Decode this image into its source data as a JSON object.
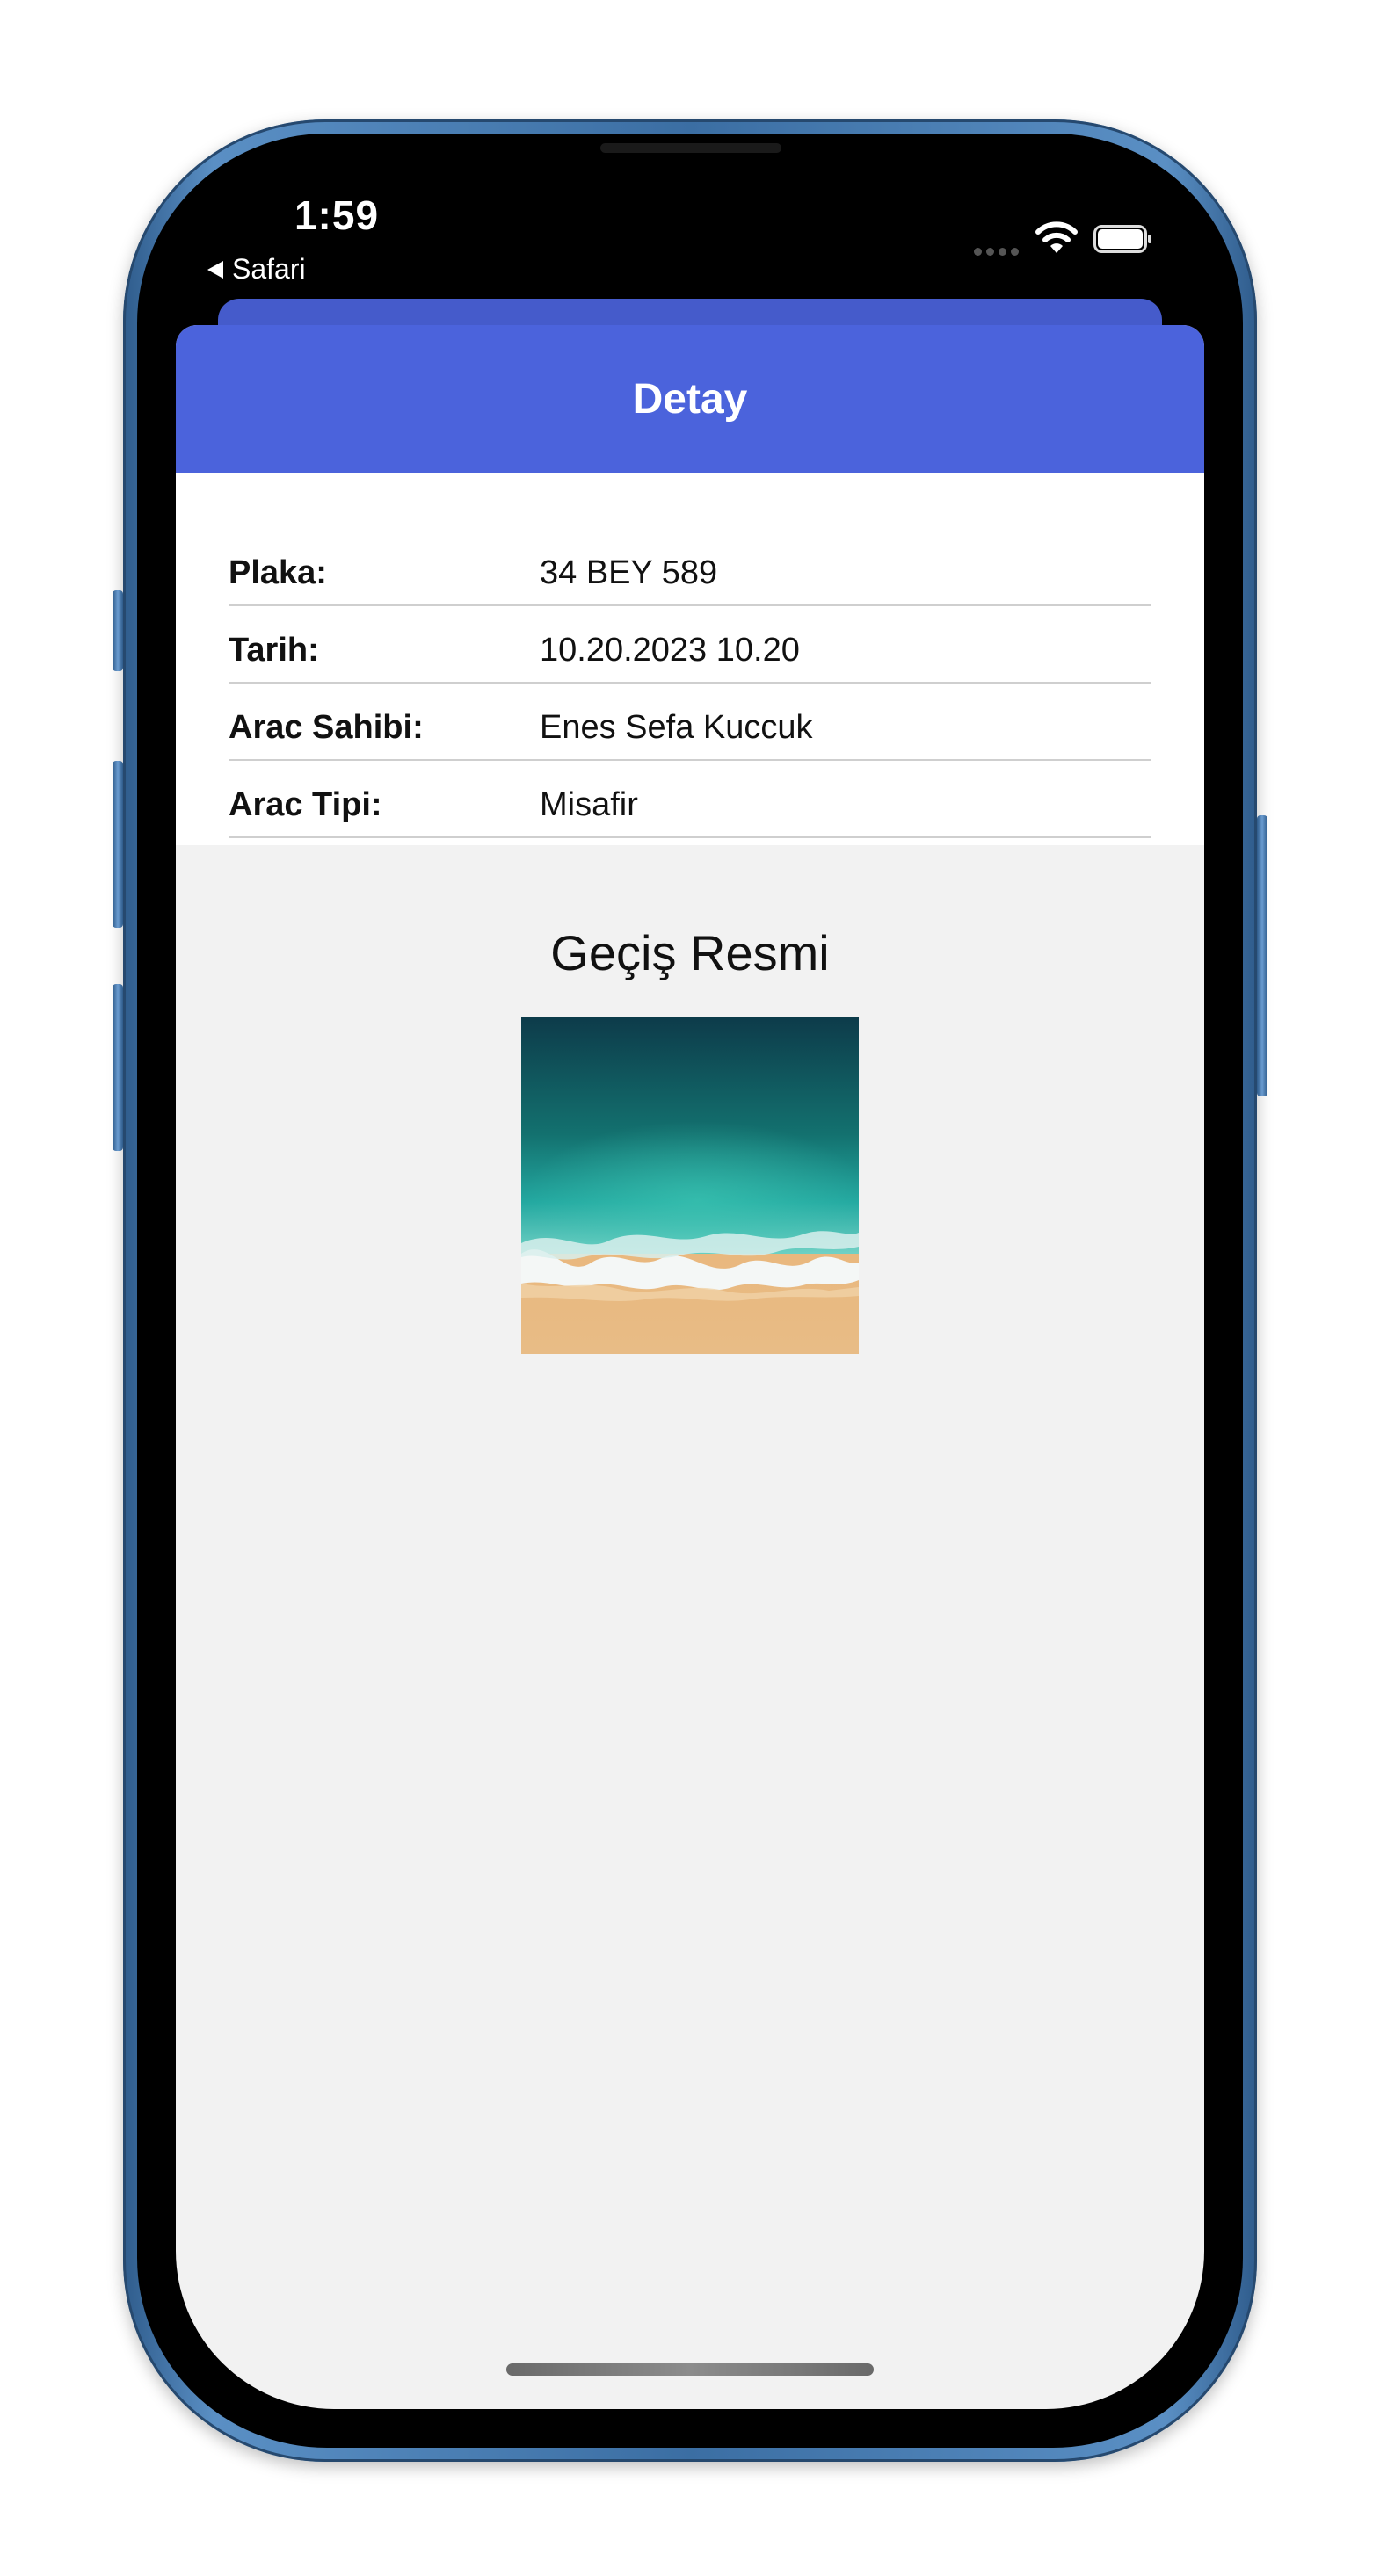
{
  "status_bar": {
    "time": "1:59",
    "back_app": "Safari"
  },
  "header": {
    "title": "Detay"
  },
  "details": [
    {
      "label": "Plaka:",
      "value": "34 BEY 589"
    },
    {
      "label": "Tarih:",
      "value": "10.20.2023 10.20"
    },
    {
      "label": "Arac Sahibi:",
      "value": "Enes Sefa Kuccuk"
    },
    {
      "label": "Arac Tipi:",
      "value": "Misafir"
    }
  ],
  "image_section": {
    "title": "Geçiş Resmi"
  },
  "colors": {
    "accent": "#4b63dc",
    "sheet_background": "#f2f2f2",
    "card_background": "#ffffff",
    "divider": "#cfcfcf",
    "phone_frame": "#3b6ea3"
  },
  "icons": {
    "back": "back-arrow-icon",
    "signal": "cellular-signal-icon",
    "wifi": "wifi-icon",
    "battery": "battery-icon"
  }
}
